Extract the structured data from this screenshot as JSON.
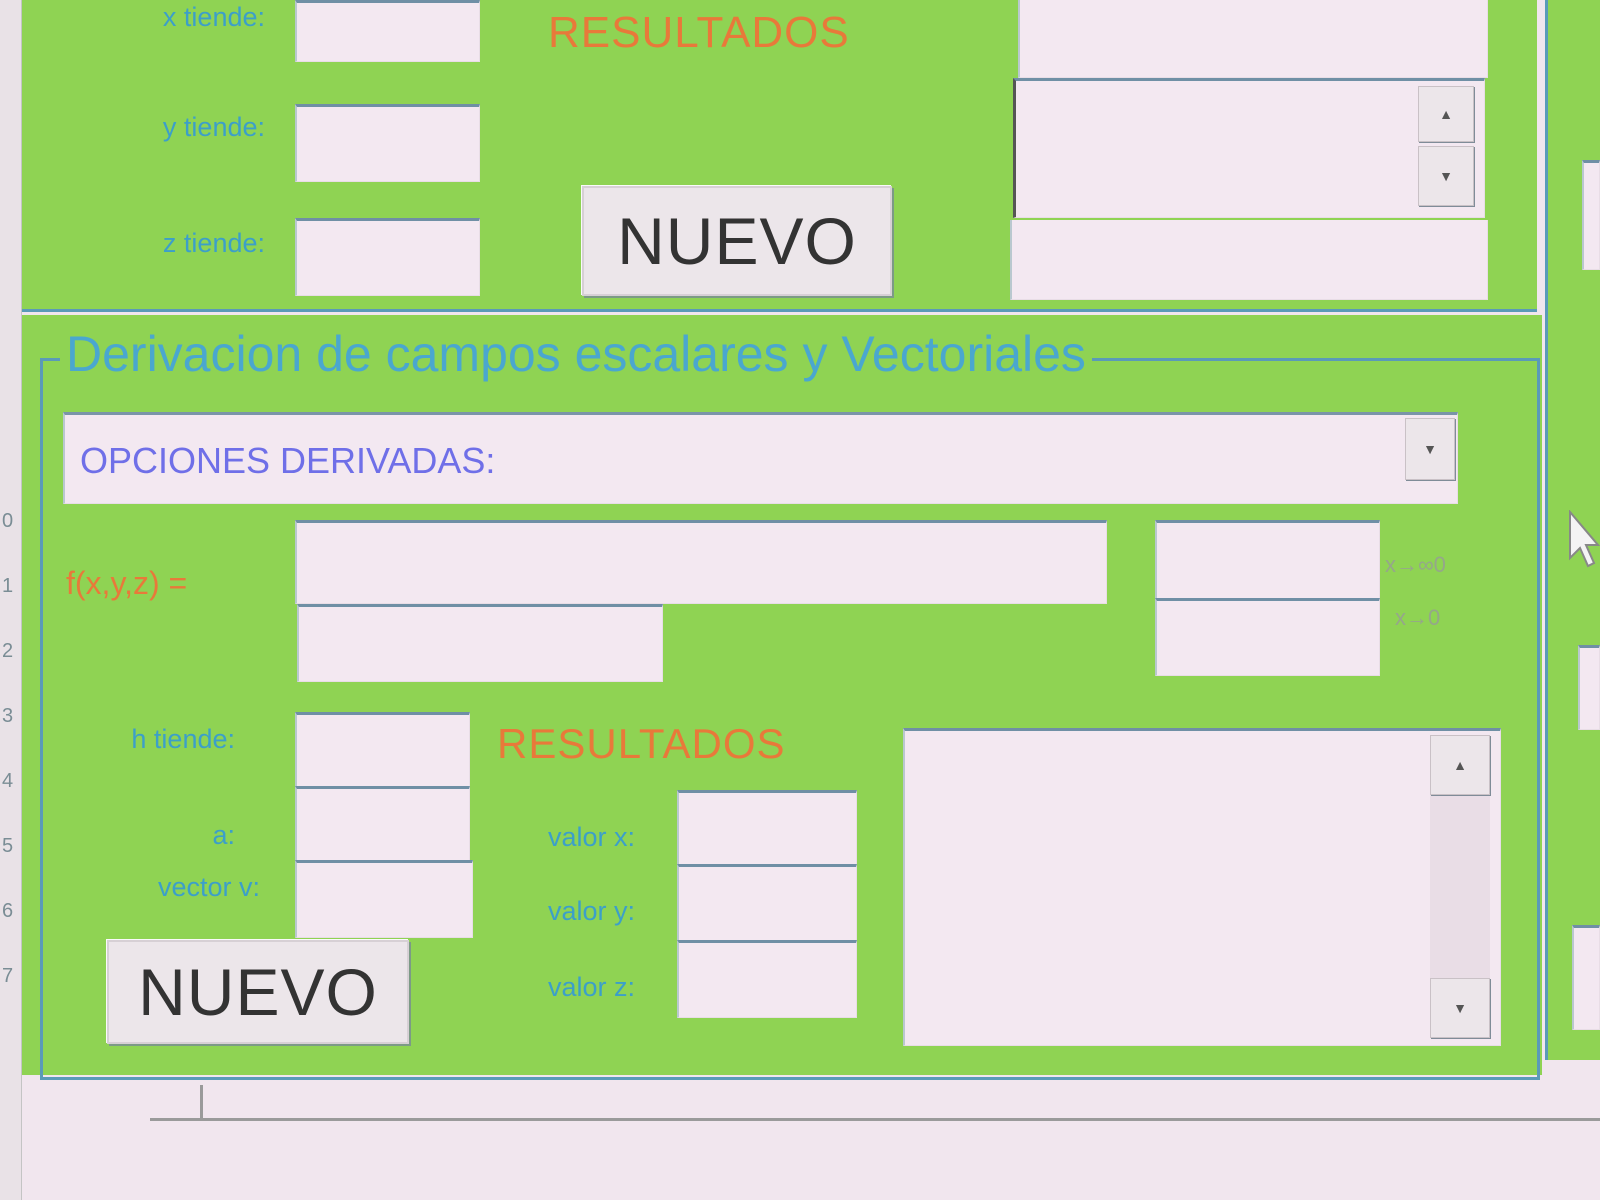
{
  "top_panel": {
    "labels": {
      "x": "x tiende:",
      "y": "y tiende:",
      "z": "z tiende:"
    },
    "results_title": "RESULTADOS",
    "new_button": "NUEVO",
    "scroll_up": "▲",
    "scroll_down": "▼"
  },
  "deriv_panel": {
    "legend": "Derivacion de campos escalares y Vectoriales",
    "options_select": "OPCIONES DERIVADAS:",
    "options_arrow": "▼",
    "function_label": "f(x,y,z) =",
    "limit_labels": [
      "x→∞0",
      "x→0"
    ],
    "left_labels": {
      "h": "h tiende:",
      "a": "a:",
      "vector": "vector v:"
    },
    "results_title": "RESULTADOS",
    "value_labels": {
      "x": "valor x:",
      "y": "valor y:",
      "z": "valor z:"
    },
    "new_button": "NUEVO",
    "scroll_up": "▲",
    "scroll_down": "▼"
  },
  "ruler": {
    "numbers": [
      "0",
      "1",
      "2",
      "3",
      "4",
      "5",
      "6",
      "7"
    ]
  },
  "colors": {
    "panel_green": "#8fd353",
    "label_blue": "#3c9fc9",
    "results_orange": "#e8793a",
    "field_bg": "#f3e8f1"
  }
}
